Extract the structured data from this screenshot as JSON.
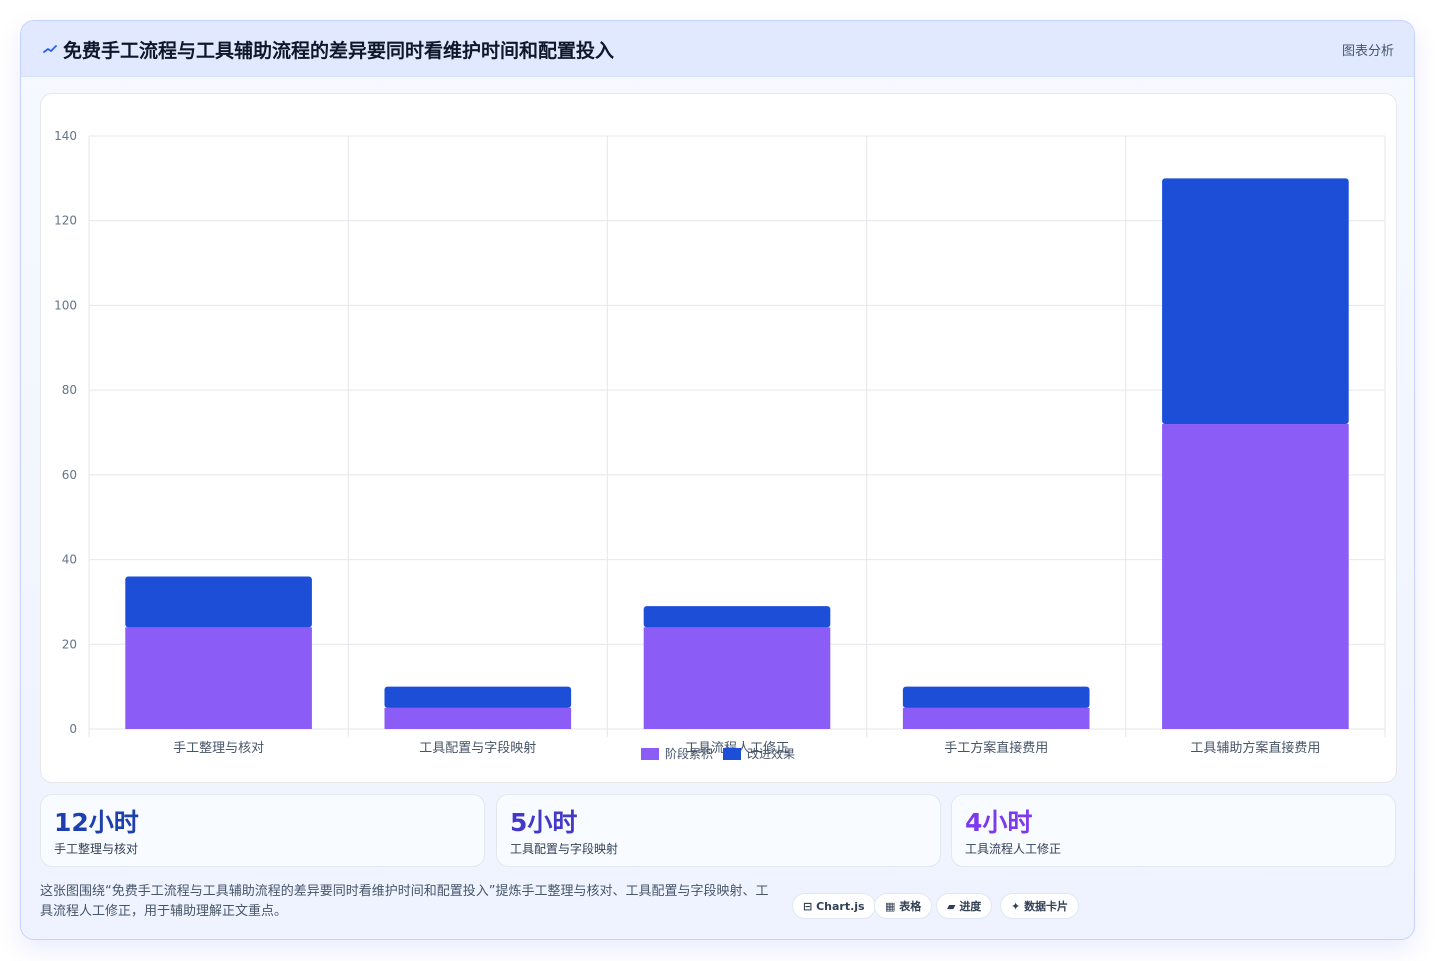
{
  "header": {
    "title": "免费手工流程与工具辅助流程的差异要同时看维护时间和配置投入",
    "badge": "图表分析",
    "icon": "line-chart-icon"
  },
  "chart_data": {
    "type": "bar",
    "stacked": true,
    "categories": [
      "手工整理与核对",
      "工具配置与字段映射",
      "工具流程人工修正",
      "手工方案直接费用",
      "工具辅助方案直接费用"
    ],
    "series": [
      {
        "name": "阶段累积",
        "color": "#8b5cf6",
        "values": [
          24,
          5,
          24,
          5,
          72
        ]
      },
      {
        "name": "改进效果",
        "color": "#1d4ed8",
        "values": [
          12,
          5,
          5,
          5,
          58
        ]
      }
    ],
    "ylim": [
      0,
      140
    ],
    "yticks": [
      "0",
      "20",
      "40",
      "60",
      "80",
      "100",
      "120",
      "140"
    ],
    "grid": true,
    "legend_position": "bottom"
  },
  "kpis": [
    {
      "value": "12小时",
      "label": "手工整理与核对",
      "color": "#1e40af"
    },
    {
      "value": "5小时",
      "label": "工具配置与字段映射",
      "color": "#4338ca"
    },
    {
      "value": "4小时",
      "label": "工具流程人工修正",
      "color": "#7c3aed"
    }
  ],
  "footer": {
    "description": "这张图围绕“免费手工流程与工具辅助流程的差异要同时看维护时间和配置投入”提炼手工整理与核对、工具配置与字段映射、工具流程人工修正，用于辅助理解正文重点。",
    "pills": [
      {
        "label": "Chart.js",
        "icon": "chart-icon",
        "glyph": "⊟"
      },
      {
        "label": "表格",
        "icon": "table-icon",
        "glyph": "▦"
      },
      {
        "label": "进度",
        "icon": "progress-icon",
        "glyph": "▰"
      },
      {
        "label": "数据卡片",
        "icon": "sparkle-icon",
        "glyph": "✦"
      }
    ]
  }
}
